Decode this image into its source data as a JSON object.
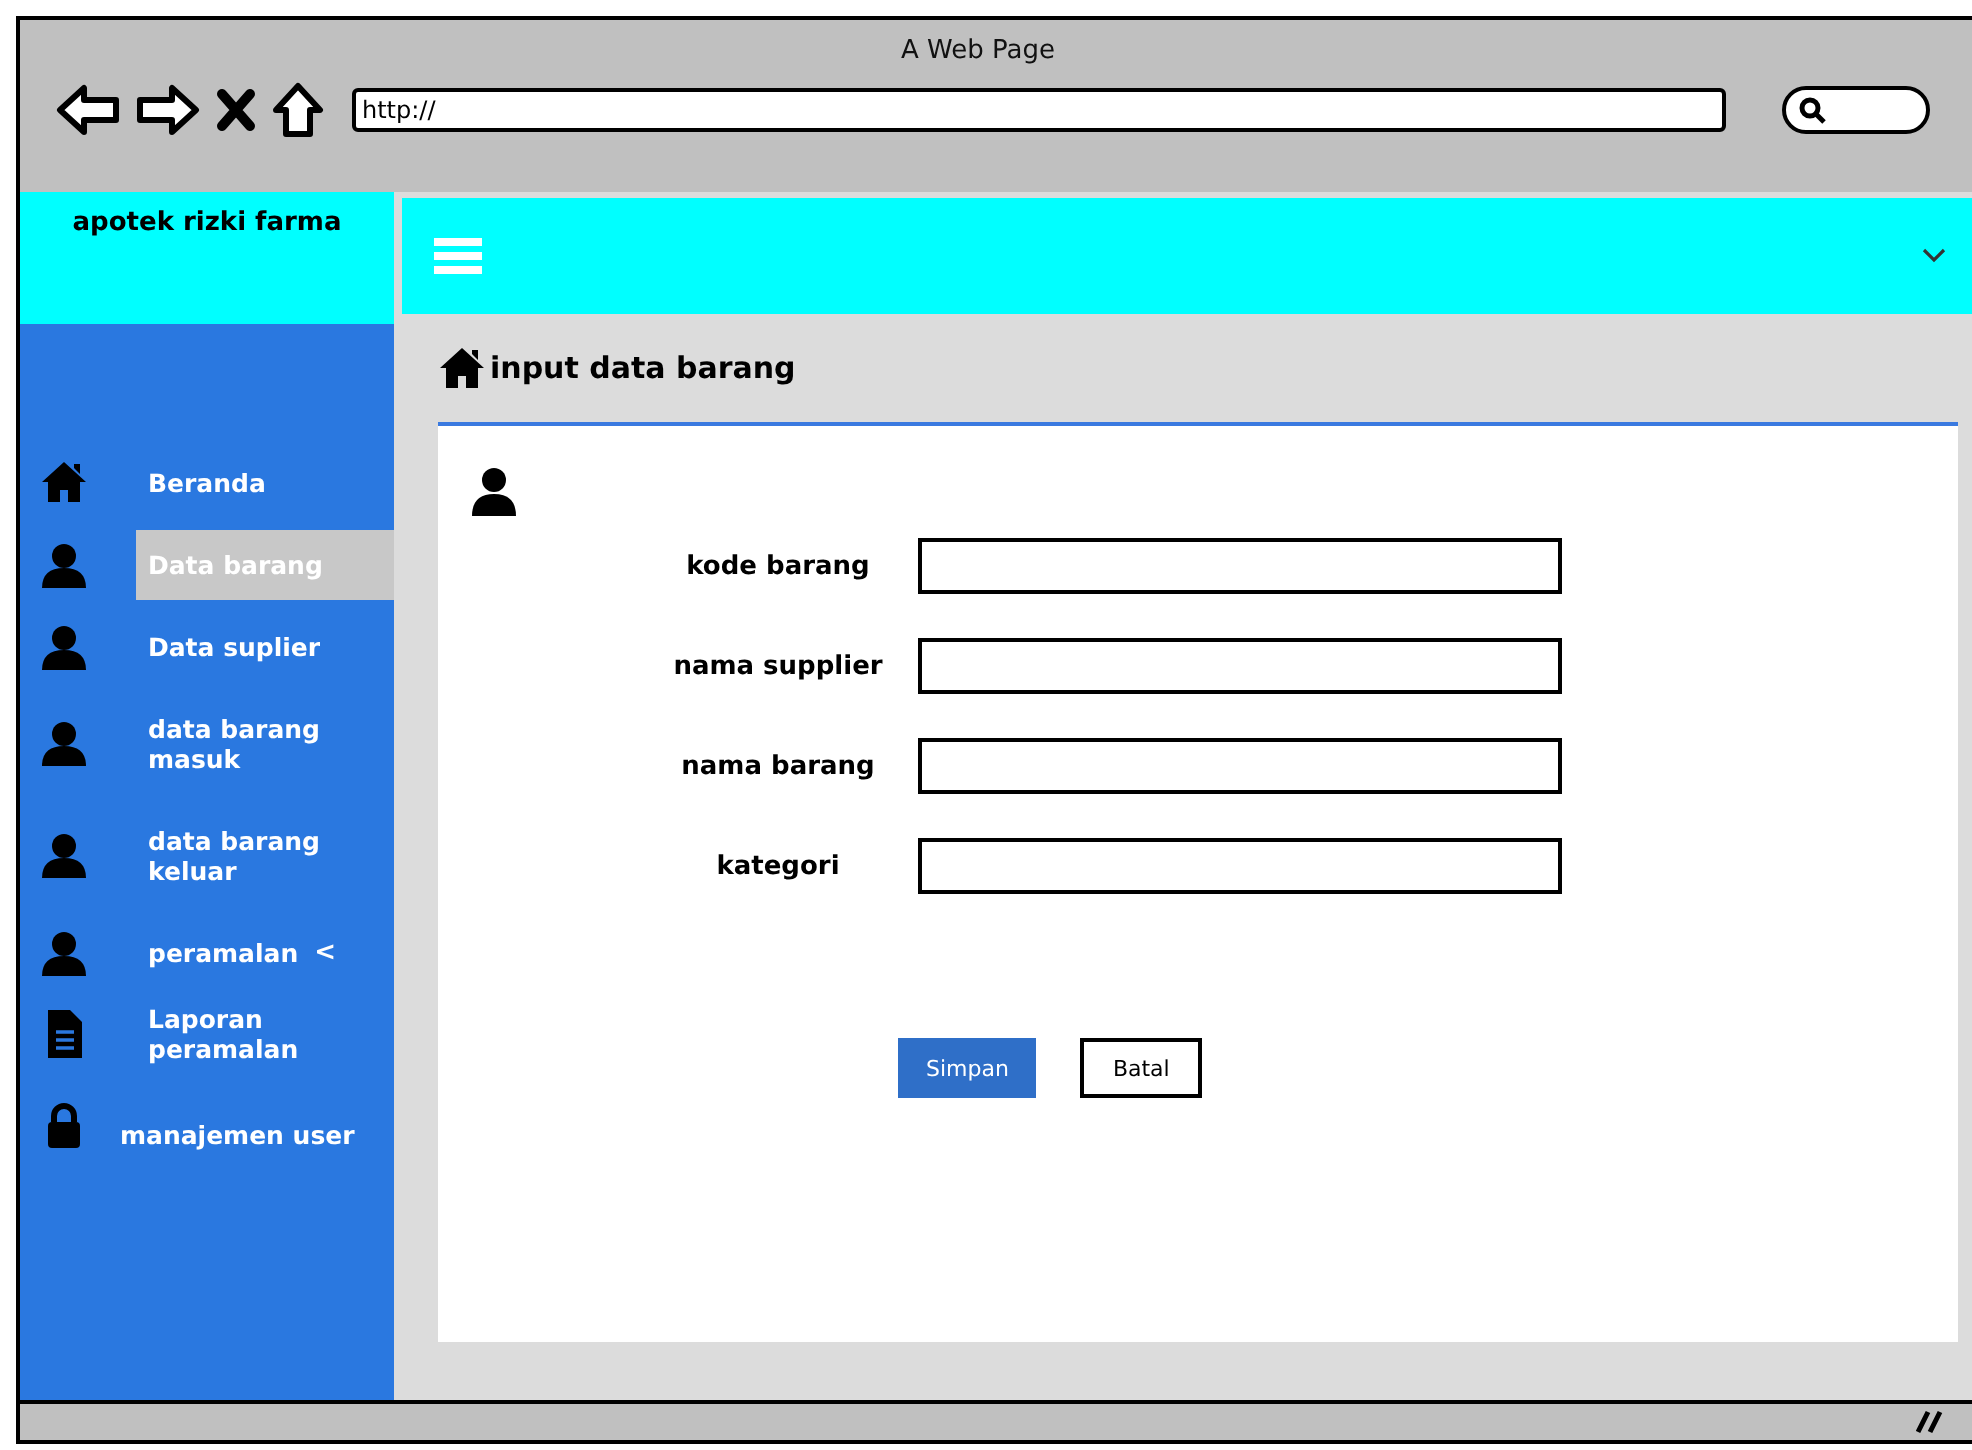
{
  "window": {
    "title": "A Web Page",
    "url": "http://"
  },
  "brand": "apotek rizki farma",
  "sidebar": {
    "items": [
      {
        "kind": "home",
        "label": "Beranda",
        "selected": false
      },
      {
        "kind": "user",
        "label": "Data barang",
        "selected": true
      },
      {
        "kind": "user",
        "label": "Data suplier",
        "selected": false
      },
      {
        "kind": "user",
        "label": "data barang masuk",
        "selected": false
      },
      {
        "kind": "user",
        "label": "data barang keluar",
        "selected": false
      },
      {
        "kind": "user",
        "label": "peramalan",
        "caret": "<",
        "selected": false
      },
      {
        "kind": "document",
        "label": "Laporan peramalan",
        "selected": false
      },
      {
        "kind": "lock",
        "label": "manajemen user",
        "selected": false
      }
    ]
  },
  "page_title": "input data barang",
  "form": {
    "fields": [
      {
        "label": "kode barang"
      },
      {
        "label": "nama supplier"
      },
      {
        "label": "nama barang"
      },
      {
        "label": "kategori"
      }
    ],
    "buttons": [
      {
        "kind": "primary",
        "label": "Simpan"
      },
      {
        "kind": "secondary",
        "label": "Batal"
      }
    ]
  }
}
